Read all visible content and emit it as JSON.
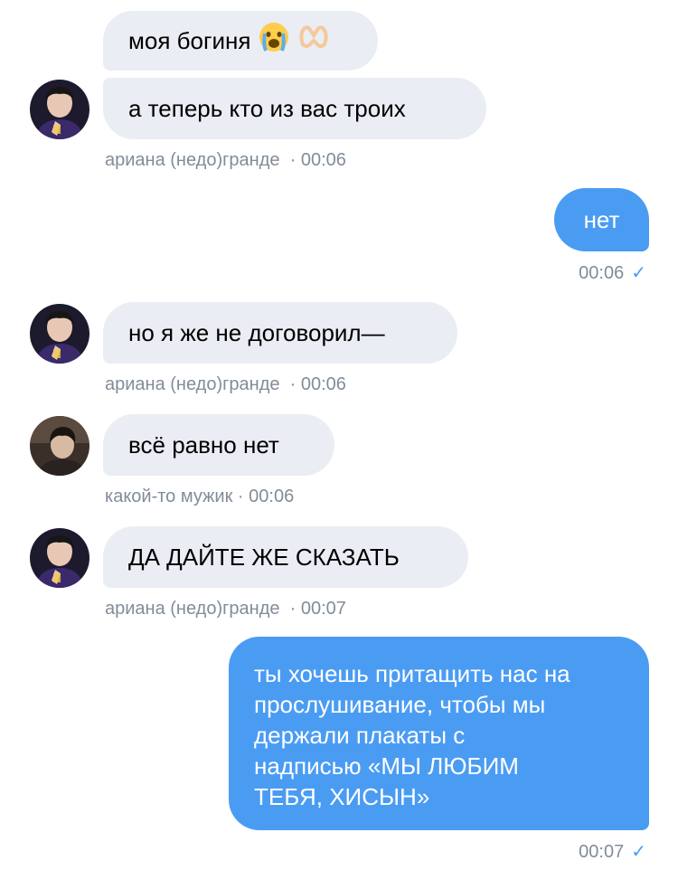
{
  "messages": [
    {
      "text": "моя богиня"
    },
    {
      "text": "а теперь кто из вас троих"
    },
    {
      "sender": "ариана (недо)гранде",
      "time": "· 00:06"
    },
    {
      "text": "нет",
      "time": "00:06",
      "check": "✓"
    },
    {
      "text": "но я же не договорил—",
      "sender": "ариана (недо)гранде",
      "time": "· 00:06"
    },
    {
      "text": "всё равно нет",
      "sender": "какой-то мужик",
      "time": "· 00:06"
    },
    {
      "text": "ДА ДАЙТЕ ЖЕ СКАЗАТЬ",
      "sender": "ариана (недо)гранде",
      "time": "· 00:07"
    },
    {
      "text_lines": [
        "ты хочешь притащить нас на",
        "прослушивание, чтобы мы",
        "держали плакаты с",
        "надписью «МЫ ЛЮБИМ",
        "ТЕБЯ, ХИСЫН»"
      ],
      "time": "00:07",
      "check": "✓"
    }
  ],
  "emoji": [
    "crying-face-icon",
    "heart-hands-icon"
  ],
  "colors": {
    "incoming_bubble": "#eaedf3",
    "outgoing_bubble": "#4a9cf3",
    "meta_text": "#818c99",
    "check": "#4a9cf3"
  }
}
